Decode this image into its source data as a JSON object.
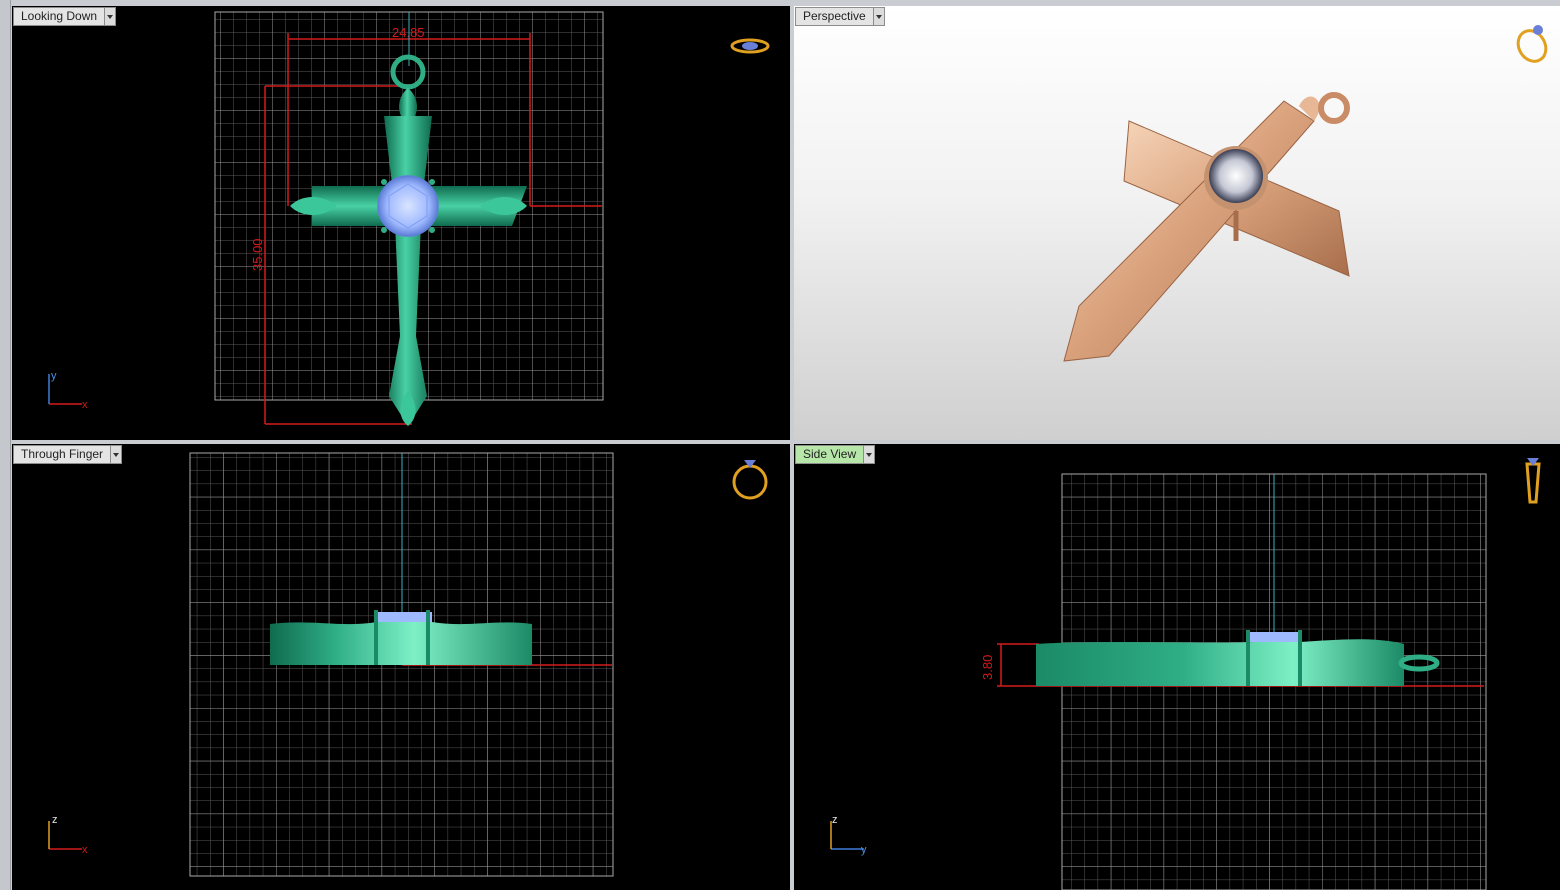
{
  "viewports": {
    "top": {
      "label": "Looking Down",
      "axis_v": "y",
      "axis_h": "x",
      "dim_width": "24.85",
      "dim_height": "35.00"
    },
    "perspective": {
      "label": "Perspective"
    },
    "front": {
      "label": "Through Finger",
      "axis_v": "z",
      "axis_h": "x"
    },
    "side": {
      "label": "Side View",
      "axis_v": "z",
      "axis_h": "y",
      "dim_height": "3.80"
    }
  },
  "colors": {
    "metal_green": "#2fae86",
    "gem_blue": "#9fb9ff",
    "rose_gold": "#e2b08f",
    "dimension_red": "#d41a1a",
    "grid": "#8a8a8a",
    "active_tab": "#b7e6a9"
  },
  "icons": [
    "ring-top-icon",
    "ring-perspective-icon",
    "ring-front-icon",
    "ring-side-icon"
  ]
}
